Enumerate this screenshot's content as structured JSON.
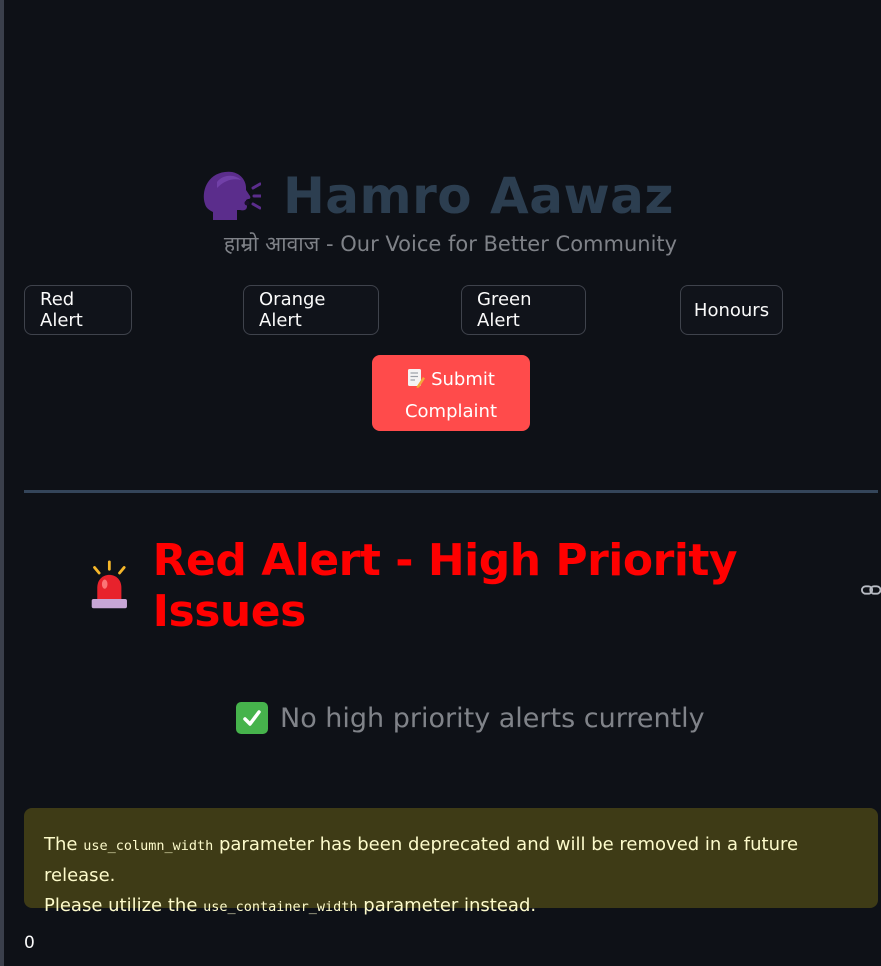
{
  "header": {
    "title": "Hamro Aawaz",
    "title_icon": "speaking-head-icon",
    "subtitle": "हाम्रो आवाज - Our Voice for Better Community"
  },
  "nav_buttons": [
    {
      "label": "Red Alert"
    },
    {
      "label": "Orange Alert"
    },
    {
      "label": "Green Alert"
    },
    {
      "label": "Honours"
    }
  ],
  "submit": {
    "label_line1": "Submit",
    "label_line2": "Complaint",
    "icon": "document-pencil-icon"
  },
  "section": {
    "icon": "siren-icon",
    "heading": "Red Alert - High Priority Issues",
    "heading_color": "#ff0000"
  },
  "status": {
    "icon": "check-mark-icon",
    "text": "No high priority alerts currently"
  },
  "warning": {
    "text_1": "The ",
    "code_1": "use_column_width",
    "text_2": " parameter has been deprecated and will be removed in a future release.",
    "text_3": "Please utilize the ",
    "code_2": "use_container_width",
    "text_4": " parameter instead."
  },
  "output": {
    "value": "0"
  },
  "colors": {
    "background": "#0e1117",
    "title": "#2c3e50",
    "primary_button": "#ff4b4b",
    "warning_background": "#3e3b16",
    "warning_text": "#fdfbcb",
    "divider": "#34455a"
  }
}
